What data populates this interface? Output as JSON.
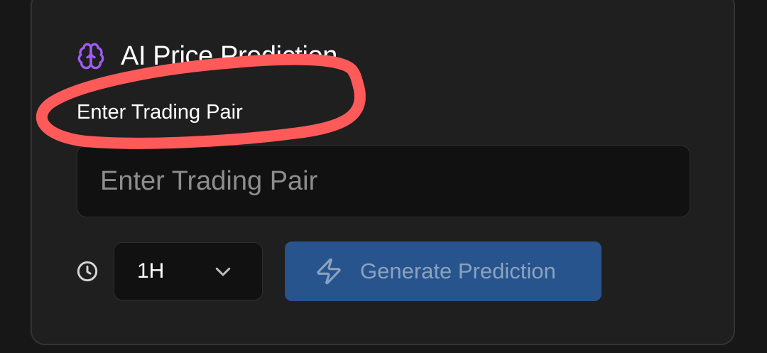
{
  "panel": {
    "title": "AI Price Prediction",
    "title_icon": "brain-icon",
    "accent_color": "#a05cf5"
  },
  "trading_pair": {
    "label": "Enter Trading Pair",
    "placeholder": "Enter Trading Pair",
    "value": ""
  },
  "timeframe": {
    "icon": "clock-icon",
    "selected": "1H",
    "dropdown_icon": "chevron-down-icon"
  },
  "generate_button": {
    "label": "Generate Prediction",
    "icon": "lightning-bolt-icon",
    "color": "#27548c",
    "state": "disabled"
  },
  "annotation": {
    "color": "#ff5a5a"
  }
}
